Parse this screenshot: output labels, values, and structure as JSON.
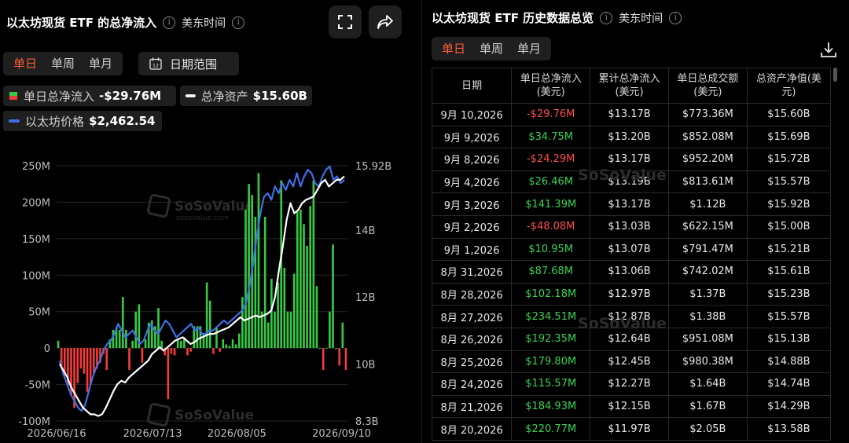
{
  "left": {
    "title": "以太坊现货 ETF 的总净流入",
    "timezone": "美东时间",
    "tabs": [
      "单日",
      "单周",
      "单月"
    ],
    "active_tab": 0,
    "date_range_label": "日期范围",
    "calendar_day": "12",
    "legend": {
      "daily": {
        "label": "单日总净流入",
        "value": "-$29.76M"
      },
      "assets": {
        "label": "总净资产",
        "value": "$15.60B"
      },
      "price": {
        "label": "以太坊价格",
        "value": "$2,462.54"
      }
    },
    "watermark": {
      "brand": "SoSoValue",
      "url": "sosovalue.com"
    }
  },
  "chart_data": {
    "type": "bar",
    "left_axis_ticks": [
      "250M",
      "200M",
      "150M",
      "100M",
      "50M",
      "0",
      "-50M",
      "-100M"
    ],
    "right_axis_ticks": [
      "15.92B",
      "14B",
      "12B",
      "10B",
      "8.3B"
    ],
    "x_ticks": [
      "2026/06/16",
      "2026/07/13",
      "2026/08/05",
      "2026/09/10"
    ],
    "ylim": [
      -100,
      250
    ],
    "y2lim": [
      8.3,
      15.92
    ],
    "colors": {
      "positive": "#36c945",
      "negative": "#f23b3b",
      "assets": "#ffffff",
      "price": "#3f6fe6"
    },
    "series": [
      {
        "values": [
          10,
          -25,
          -38,
          -52,
          -65,
          -82,
          -48,
          -28,
          -35,
          -60,
          -50,
          -35,
          -28,
          -20,
          -8,
          -30,
          12,
          25,
          28,
          25,
          70,
          25,
          -30,
          10,
          50,
          60,
          -20,
          12,
          35,
          38,
          30,
          55,
          10,
          -10,
          -70,
          -8,
          -10,
          12,
          10,
          15,
          -10,
          -5,
          30,
          30,
          30,
          18,
          90,
          65,
          -8,
          28,
          -5,
          12,
          5,
          3,
          12,
          5,
          20,
          70,
          190,
          225,
          210,
          180,
          240,
          50,
          180,
          35,
          95,
          50,
          90,
          230,
          110,
          50,
          50,
          102,
          188,
          190,
          170,
          140,
          195,
          230,
          85,
          0,
          -30,
          0,
          50,
          142,
          0,
          -24,
          35,
          -30
        ]
      },
      {
        "values": [
          10.0,
          9.8,
          9.6,
          9.3,
          9.1,
          8.9,
          8.7,
          8.6,
          8.5,
          8.5,
          8.45,
          8.5,
          8.7,
          8.95,
          9.2,
          9.4,
          9.5,
          9.45,
          9.6,
          9.7,
          9.8,
          9.9,
          10.0,
          10.1,
          10.3,
          10.4,
          10.5,
          10.4,
          10.5,
          10.6,
          10.7,
          10.75,
          10.8,
          10.7,
          10.6,
          10.65,
          10.75,
          10.8,
          10.85,
          10.9,
          10.9,
          10.95,
          11.0,
          11.05,
          11.1,
          11.2,
          11.3,
          11.4,
          11.3,
          11.35,
          11.4,
          11.45,
          11.4,
          11.45,
          11.5,
          11.6,
          12.0,
          12.8,
          13.5,
          14.3,
          14.8,
          14.5,
          14.6,
          14.8,
          14.9,
          14.95,
          15.0,
          15.2,
          15.4,
          15.5,
          15.3,
          15.4,
          15.5,
          15.5,
          15.6
        ]
      },
      {
        "values": [
          10.1,
          9.7,
          9.4,
          9.1,
          8.9,
          8.7,
          8.6,
          8.8,
          9.2,
          9.6,
          9.9,
          10.1,
          10.4,
          10.6,
          10.7,
          10.9,
          11.2,
          11.0,
          10.8,
          10.9,
          11.0,
          10.8,
          10.6,
          10.7,
          11.0,
          11.2,
          11.0,
          10.9,
          11.1,
          11.3,
          11.2,
          11.0,
          10.8,
          10.9,
          11.0,
          11.1,
          11.2,
          11.0,
          11.1,
          10.9,
          10.9,
          11.0,
          11.0,
          11.1,
          11.2,
          11.3,
          11.2,
          11.3,
          11.4,
          11.5,
          11.6,
          11.8,
          12.3,
          13.0,
          13.8,
          14.5,
          15.0,
          15.1,
          14.9,
          15.3,
          15.1,
          15.4,
          15.2,
          15.5,
          15.3,
          15.7,
          15.3,
          15.6,
          15.8,
          15.7,
          15.4,
          15.3,
          15.6,
          15.8,
          15.9,
          15.5,
          15.6,
          15.4,
          15.5
        ]
      }
    ]
  },
  "right": {
    "title": "以太坊现货 ETF 历史数据总览",
    "timezone": "美东时间",
    "tabs": [
      "单日",
      "单周",
      "单月"
    ],
    "active_tab": 0,
    "columns": [
      {
        "l1": "日期",
        "l2": ""
      },
      {
        "l1": "单日总净流入",
        "l2": "(美元)"
      },
      {
        "l1": "累计总净流入",
        "l2": "(美元)"
      },
      {
        "l1": "单日总成交额",
        "l2": "(美元)"
      },
      {
        "l1": "总资产净值(美",
        "l2": "元)"
      }
    ],
    "rows": [
      {
        "date": "9月 10,2026",
        "flow": "-$29.76M",
        "sign": "neg",
        "cum": "$13.17B",
        "vol": "$773.36M",
        "nav": "$15.60B"
      },
      {
        "date": "9月 9,2026",
        "flow": "$34.75M",
        "sign": "pos",
        "cum": "$13.20B",
        "vol": "$852.08M",
        "nav": "$15.69B"
      },
      {
        "date": "9月 8,2026",
        "flow": "-$24.29M",
        "sign": "neg",
        "cum": "$13.17B",
        "vol": "$952.20M",
        "nav": "$15.72B"
      },
      {
        "date": "9月 4,2026",
        "flow": "$26.46M",
        "sign": "pos",
        "cum": "$13.19B",
        "vol": "$813.61M",
        "nav": "$15.57B"
      },
      {
        "date": "9月 3,2026",
        "flow": "$141.39M",
        "sign": "pos",
        "cum": "$13.17B",
        "vol": "$1.12B",
        "nav": "$15.92B"
      },
      {
        "date": "9月 2,2026",
        "flow": "-$48.08M",
        "sign": "neg",
        "cum": "$13.03B",
        "vol": "$622.15M",
        "nav": "$15.00B"
      },
      {
        "date": "9月 1,2026",
        "flow": "$10.95M",
        "sign": "pos",
        "cum": "$13.07B",
        "vol": "$791.47M",
        "nav": "$15.21B"
      },
      {
        "date": "8月 31,2026",
        "flow": "$87.68M",
        "sign": "pos",
        "cum": "$13.06B",
        "vol": "$742.02M",
        "nav": "$15.61B"
      },
      {
        "date": "8月 28,2026",
        "flow": "$102.18M",
        "sign": "pos",
        "cum": "$12.97B",
        "vol": "$1.37B",
        "nav": "$15.23B"
      },
      {
        "date": "8月 27,2026",
        "flow": "$234.51M",
        "sign": "pos",
        "cum": "$12.87B",
        "vol": "$1.38B",
        "nav": "$15.57B"
      },
      {
        "date": "8月 26,2026",
        "flow": "$192.35M",
        "sign": "pos",
        "cum": "$12.64B",
        "vol": "$951.08M",
        "nav": "$15.13B"
      },
      {
        "date": "8月 25,2026",
        "flow": "$179.80M",
        "sign": "pos",
        "cum": "$12.45B",
        "vol": "$980.38M",
        "nav": "$14.88B"
      },
      {
        "date": "8月 24,2026",
        "flow": "$115.57M",
        "sign": "pos",
        "cum": "$12.27B",
        "vol": "$1.64B",
        "nav": "$14.74B"
      },
      {
        "date": "8月 21,2026",
        "flow": "$184.93M",
        "sign": "pos",
        "cum": "$12.15B",
        "vol": "$1.67B",
        "nav": "$14.29B"
      },
      {
        "date": "8月 20,2026",
        "flow": "$220.77M",
        "sign": "pos",
        "cum": "$11.97B",
        "vol": "$2.05B",
        "nav": "$13.58B"
      }
    ]
  }
}
